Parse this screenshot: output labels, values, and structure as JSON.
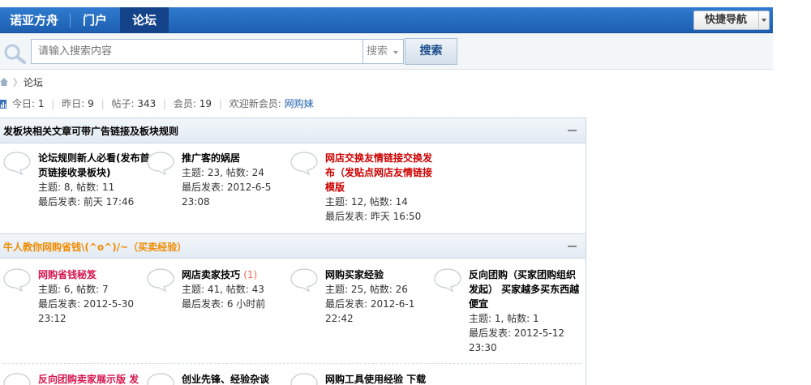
{
  "nav": {
    "items": [
      {
        "label": "诺亚方舟"
      },
      {
        "label": "门户"
      },
      {
        "label": "论坛"
      }
    ],
    "quick_nav": "快捷导航"
  },
  "search": {
    "placeholder": "请输入搜索内容",
    "type": "搜索",
    "button": "搜索"
  },
  "breadcrumb": {
    "separator": "〉",
    "current": "论坛"
  },
  "stats": {
    "today_label": "今日:",
    "today": "1",
    "yesterday_label": "昨日:",
    "yesterday": "9",
    "posts_label": "帖子:",
    "posts": "343",
    "members_label": "会员:",
    "members": "19",
    "welcome_label": "欢迎新会员:",
    "new_member": "网购妹"
  },
  "categories": [
    {
      "title": "发板块相关文章可带广告链接及板块规则",
      "title_color": "#000000",
      "forums": [
        {
          "name": "论坛规则新人必看(发布首页链接收录板块)",
          "topics": "主题: 8, 帖数: 11",
          "last": "最后发表: 前天 17:46"
        },
        {
          "name": "推广客的娲居",
          "topics": "主题: 23, 帖数: 24",
          "last": "最后发表: 2012-6-5 23:08"
        },
        {
          "name": "网店交换友情链接交换发布（发贴点网店友情链接模版",
          "topics": "主题: 12, 帖数: 14",
          "last": "最后发表: 昨天 16:50"
        }
      ]
    },
    {
      "title": "牛人教你网购省钱\\(^o^)/~（买卖经验）",
      "title_color": "#f08c00",
      "forums": [
        {
          "name": "网购省钱秘笈",
          "topics": "主题: 6, 帖数: 7",
          "last": "最后发表: 2012-5-30 23:12"
        },
        {
          "name": "网店卖家技巧",
          "new": "(1)",
          "topics": "主题: 41, 帖数: 43",
          "last": "最后发表: 6 小时前"
        },
        {
          "name": "网购买家经验",
          "topics": "主题: 25, 帖数: 26",
          "last": "最后发表: 2012-6-1 22:42"
        },
        {
          "name": "反向团购（买家团购组织发起） 买家越多买东西越便宜",
          "topics": "主题: 1, 帖数: 1",
          "last": "最后发表: 2012-5-12 23:30"
        }
      ],
      "more_forums": [
        {
          "name": "反向团购卖家展示版 发"
        },
        {
          "name": "创业先锋、经验杂谈"
        },
        {
          "name": "网购工具使用经验 下载"
        }
      ]
    }
  ],
  "colors": {
    "nav_bg": "#1d5fb0",
    "link": "#1d5fb0",
    "forum_red": "#cc0000",
    "forum_pink": "#d6174f",
    "category_orange": "#f08c00"
  }
}
